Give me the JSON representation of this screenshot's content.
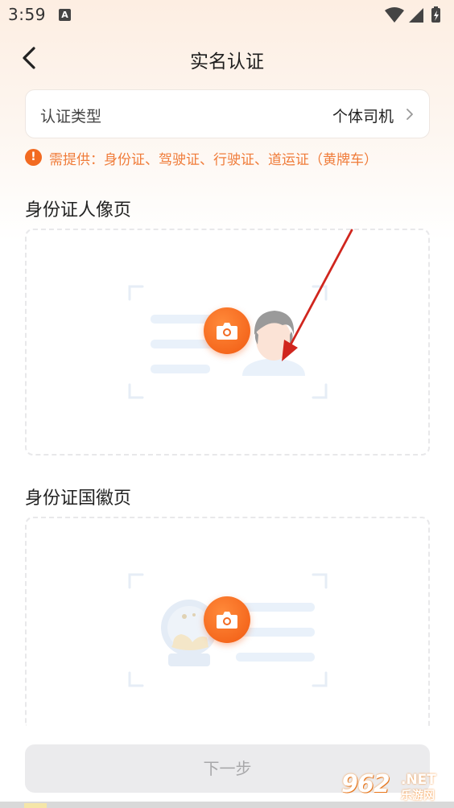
{
  "status_bar": {
    "time": "3:59",
    "notification_badge": "A"
  },
  "header": {
    "title": "实名认证",
    "back_icon": "chevron-left-icon"
  },
  "certification_type": {
    "label": "认证类型",
    "value": "个体司机"
  },
  "notice": {
    "icon": "!",
    "text": "需提供：身份证、驾驶证、行驶证、道运证（黄牌车）",
    "color": "#f07c3a"
  },
  "sections": [
    {
      "title": "身份证人像页",
      "icon": "camera-icon"
    },
    {
      "title": "身份证国徽页",
      "icon": "camera-icon"
    }
  ],
  "footer": {
    "next_label": "下一步"
  },
  "watermark": {
    "logo": "962",
    "net": ".NET",
    "sub": "乐游网"
  },
  "colors": {
    "accent": "#f26a21",
    "annotation_arrow": "#d0261e",
    "disabled_button": "#ebebed"
  }
}
